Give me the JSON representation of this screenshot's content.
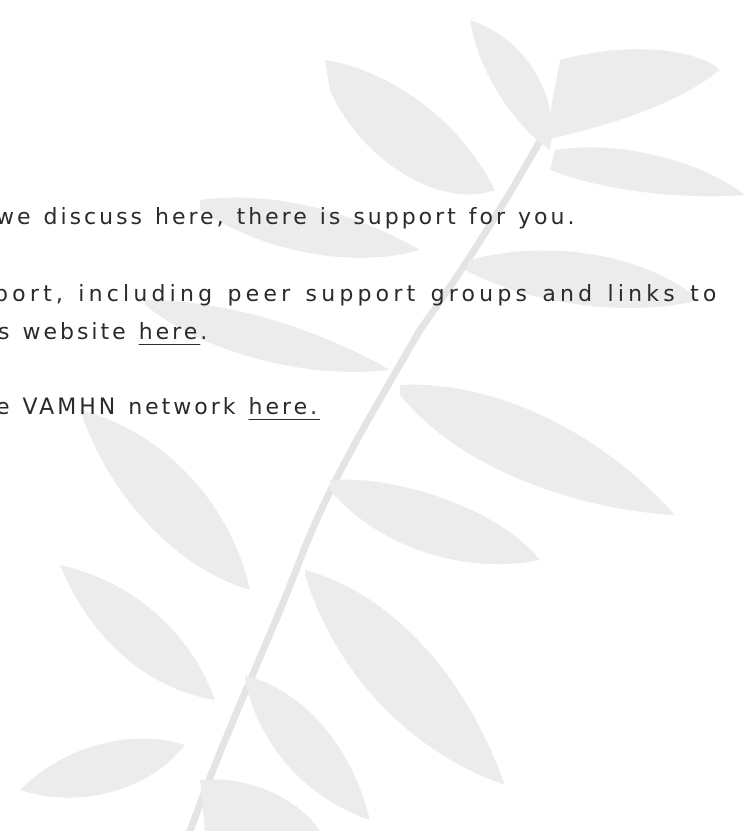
{
  "paragraphs": {
    "p1": {
      "text": "we discuss here, there is support for you."
    },
    "p2": {
      "line1": "port, including peer support groups and links to",
      "line2_prefix": "s website ",
      "line2_link": "here",
      "line2_suffix": "."
    },
    "p3": {
      "prefix": "e VAMHN network ",
      "link": "here."
    }
  },
  "colors": {
    "background": "#ffffff",
    "text": "#2b2b2b",
    "leaf": "#e9e9e9",
    "stem": "#e2e2e2"
  },
  "decor": {
    "background_image": "leaf-branch-watermark"
  }
}
